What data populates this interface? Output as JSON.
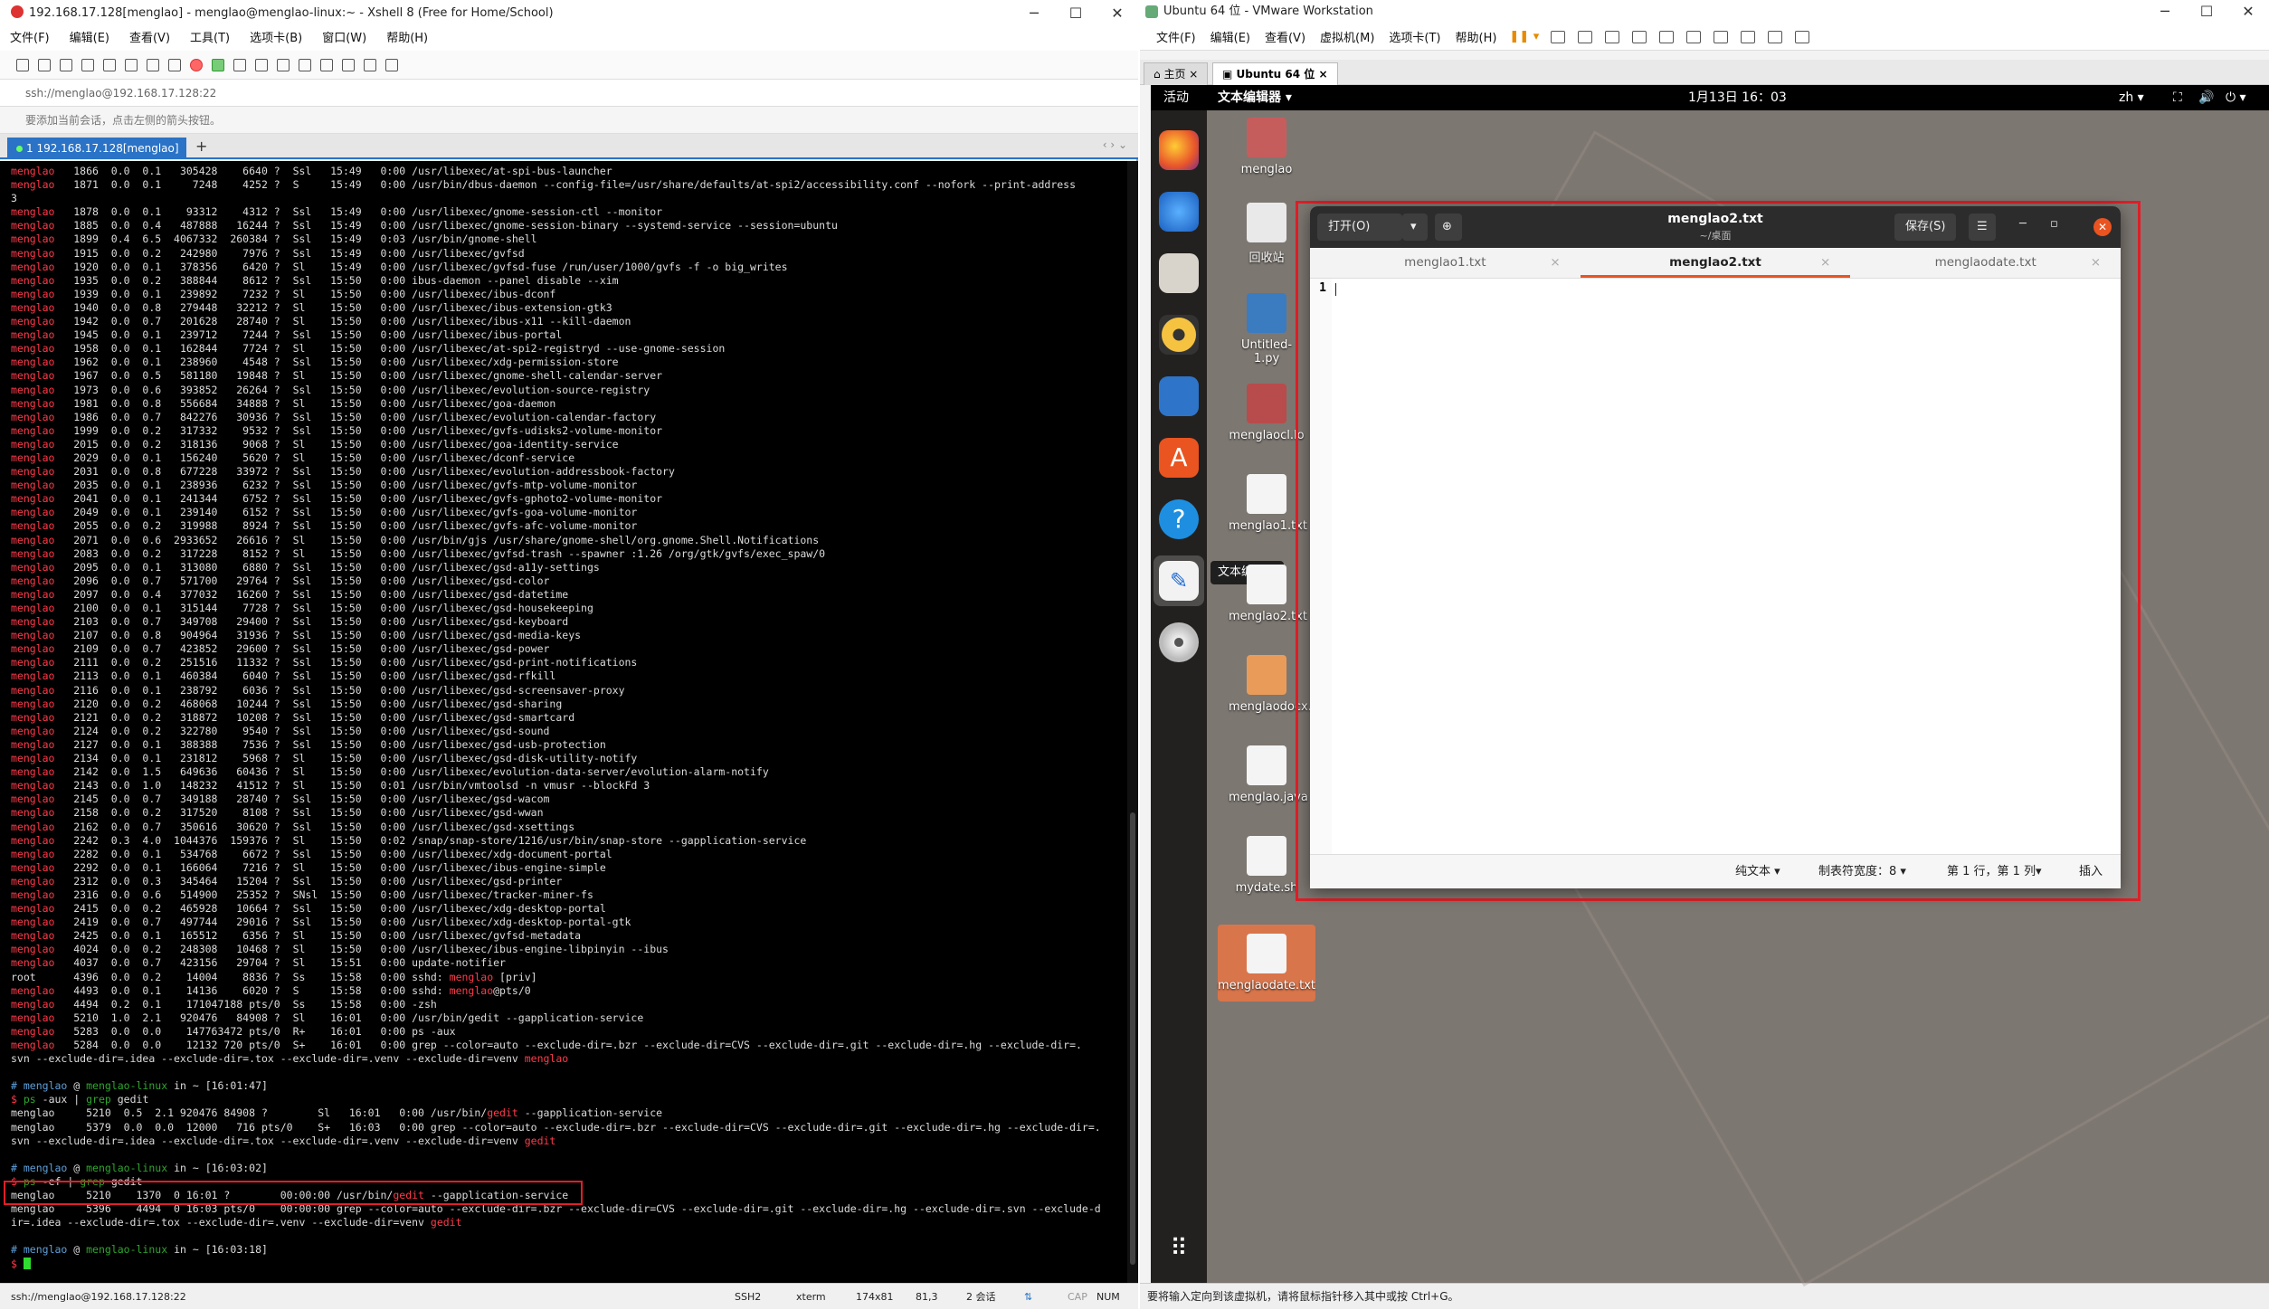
{
  "xshell": {
    "title": "192.168.17.128[menglao] - menglao@menglao-linux:~ - Xshell 8 (Free for Home/School)",
    "menu": [
      "文件(F)",
      "编辑(E)",
      "查看(V)",
      "工具(T)",
      "选项卡(B)",
      "窗口(W)",
      "帮助(H)"
    ],
    "address": "ssh://menglao@192.168.17.128:22",
    "hint": "要添加当前会话，点击左侧的箭头按钮。",
    "tab_label": "1 192.168.17.128[menglao]",
    "status": {
      "conn": "ssh://menglao@192.168.17.128:22",
      "proto": "SSH2",
      "term": "xterm",
      "size": "174x81",
      "pos": "81,3",
      "sessions": "2 会话",
      "caps": "CAP",
      "num": "NUM"
    }
  },
  "terminal": {
    "processes": [
      [
        "menglao",
        "1866",
        "0.0",
        "0.1",
        "305428",
        "6640 ?",
        "Ssl",
        "15:49",
        "0:00 /usr/libexec/at-spi-bus-launcher"
      ],
      [
        "menglao",
        "1871",
        "0.0",
        "0.1",
        "7248",
        "4252 ?",
        "S",
        "15:49",
        "0:00 /usr/bin/dbus-daemon --config-file=/usr/share/defaults/at-spi2/accessibility.conf --nofork --print-address"
      ],
      [
        "",
        "",
        "",
        "",
        "",
        "",
        "",
        "",
        "3"
      ],
      [
        "menglao",
        "1878",
        "0.0",
        "0.1",
        "93312",
        "4312 ?",
        "Ssl",
        "15:49",
        "0:00 /usr/libexec/gnome-session-ctl --monitor"
      ],
      [
        "menglao",
        "1885",
        "0.0",
        "0.4",
        "487888",
        "16244 ?",
        "Ssl",
        "15:49",
        "0:00 /usr/libexec/gnome-session-binary --systemd-service --session=ubuntu"
      ],
      [
        "menglao",
        "1899",
        "0.4",
        "6.5",
        "4067332",
        "260384 ?",
        "Ssl",
        "15:49",
        "0:03 /usr/bin/gnome-shell"
      ],
      [
        "menglao",
        "1915",
        "0.0",
        "0.2",
        "242980",
        "7976 ?",
        "Ssl",
        "15:49",
        "0:00 /usr/libexec/gvfsd"
      ],
      [
        "menglao",
        "1920",
        "0.0",
        "0.1",
        "378356",
        "6420 ?",
        "Sl",
        "15:49",
        "0:00 /usr/libexec/gvfsd-fuse /run/user/1000/gvfs -f -o big_writes"
      ],
      [
        "menglao",
        "1935",
        "0.0",
        "0.2",
        "388844",
        "8612 ?",
        "Ssl",
        "15:50",
        "0:00 ibus-daemon --panel disable --xim"
      ],
      [
        "menglao",
        "1939",
        "0.0",
        "0.1",
        "239892",
        "7232 ?",
        "Sl",
        "15:50",
        "0:00 /usr/libexec/ibus-dconf"
      ],
      [
        "menglao",
        "1940",
        "0.0",
        "0.8",
        "279448",
        "32212 ?",
        "Sl",
        "15:50",
        "0:00 /usr/libexec/ibus-extension-gtk3"
      ],
      [
        "menglao",
        "1942",
        "0.0",
        "0.7",
        "201628",
        "28740 ?",
        "Sl",
        "15:50",
        "0:00 /usr/libexec/ibus-x11 --kill-daemon"
      ],
      [
        "menglao",
        "1945",
        "0.0",
        "0.1",
        "239712",
        "7244 ?",
        "Ssl",
        "15:50",
        "0:00 /usr/libexec/ibus-portal"
      ],
      [
        "menglao",
        "1958",
        "0.0",
        "0.1",
        "162844",
        "7724 ?",
        "Sl",
        "15:50",
        "0:00 /usr/libexec/at-spi2-registryd --use-gnome-session"
      ],
      [
        "menglao",
        "1962",
        "0.0",
        "0.1",
        "238960",
        "4548 ?",
        "Ssl",
        "15:50",
        "0:00 /usr/libexec/xdg-permission-store"
      ],
      [
        "menglao",
        "1967",
        "0.0",
        "0.5",
        "581180",
        "19848 ?",
        "Sl",
        "15:50",
        "0:00 /usr/libexec/gnome-shell-calendar-server"
      ],
      [
        "menglao",
        "1973",
        "0.0",
        "0.6",
        "393852",
        "26264 ?",
        "Ssl",
        "15:50",
        "0:00 /usr/libexec/evolution-source-registry"
      ],
      [
        "menglao",
        "1981",
        "0.0",
        "0.8",
        "556684",
        "34888 ?",
        "Sl",
        "15:50",
        "0:00 /usr/libexec/goa-daemon"
      ],
      [
        "menglao",
        "1986",
        "0.0",
        "0.7",
        "842276",
        "30936 ?",
        "Ssl",
        "15:50",
        "0:00 /usr/libexec/evolution-calendar-factory"
      ],
      [
        "menglao",
        "1999",
        "0.0",
        "0.2",
        "317332",
        "9532 ?",
        "Ssl",
        "15:50",
        "0:00 /usr/libexec/gvfs-udisks2-volume-monitor"
      ],
      [
        "menglao",
        "2015",
        "0.0",
        "0.2",
        "318136",
        "9068 ?",
        "Sl",
        "15:50",
        "0:00 /usr/libexec/goa-identity-service"
      ],
      [
        "menglao",
        "2029",
        "0.0",
        "0.1",
        "156240",
        "5620 ?",
        "Sl",
        "15:50",
        "0:00 /usr/libexec/dconf-service"
      ],
      [
        "menglao",
        "2031",
        "0.0",
        "0.8",
        "677228",
        "33972 ?",
        "Ssl",
        "15:50",
        "0:00 /usr/libexec/evolution-addressbook-factory"
      ],
      [
        "menglao",
        "2035",
        "0.0",
        "0.1",
        "238936",
        "6232 ?",
        "Ssl",
        "15:50",
        "0:00 /usr/libexec/gvfs-mtp-volume-monitor"
      ],
      [
        "menglao",
        "2041",
        "0.0",
        "0.1",
        "241344",
        "6752 ?",
        "Ssl",
        "15:50",
        "0:00 /usr/libexec/gvfs-gphoto2-volume-monitor"
      ],
      [
        "menglao",
        "2049",
        "0.0",
        "0.1",
        "239140",
        "6152 ?",
        "Ssl",
        "15:50",
        "0:00 /usr/libexec/gvfs-goa-volume-monitor"
      ],
      [
        "menglao",
        "2055",
        "0.0",
        "0.2",
        "319988",
        "8924 ?",
        "Ssl",
        "15:50",
        "0:00 /usr/libexec/gvfs-afc-volume-monitor"
      ],
      [
        "menglao",
        "2071",
        "0.0",
        "0.6",
        "2933652",
        "26616 ?",
        "Sl",
        "15:50",
        "0:00 /usr/bin/gjs /usr/share/gnome-shell/org.gnome.Shell.Notifications"
      ],
      [
        "menglao",
        "2083",
        "0.0",
        "0.2",
        "317228",
        "8152 ?",
        "Sl",
        "15:50",
        "0:00 /usr/libexec/gvfsd-trash --spawner :1.26 /org/gtk/gvfs/exec_spaw/0"
      ],
      [
        "menglao",
        "2095",
        "0.0",
        "0.1",
        "313080",
        "6880 ?",
        "Ssl",
        "15:50",
        "0:00 /usr/libexec/gsd-a11y-settings"
      ],
      [
        "menglao",
        "2096",
        "0.0",
        "0.7",
        "571700",
        "29764 ?",
        "Ssl",
        "15:50",
        "0:00 /usr/libexec/gsd-color"
      ],
      [
        "menglao",
        "2097",
        "0.0",
        "0.4",
        "377032",
        "16260 ?",
        "Ssl",
        "15:50",
        "0:00 /usr/libexec/gsd-datetime"
      ],
      [
        "menglao",
        "2100",
        "0.0",
        "0.1",
        "315144",
        "7728 ?",
        "Ssl",
        "15:50",
        "0:00 /usr/libexec/gsd-housekeeping"
      ],
      [
        "menglao",
        "2103",
        "0.0",
        "0.7",
        "349708",
        "29400 ?",
        "Ssl",
        "15:50",
        "0:00 /usr/libexec/gsd-keyboard"
      ],
      [
        "menglao",
        "2107",
        "0.0",
        "0.8",
        "904964",
        "31936 ?",
        "Ssl",
        "15:50",
        "0:00 /usr/libexec/gsd-media-keys"
      ],
      [
        "menglao",
        "2109",
        "0.0",
        "0.7",
        "423852",
        "29600 ?",
        "Ssl",
        "15:50",
        "0:00 /usr/libexec/gsd-power"
      ],
      [
        "menglao",
        "2111",
        "0.0",
        "0.2",
        "251516",
        "11332 ?",
        "Ssl",
        "15:50",
        "0:00 /usr/libexec/gsd-print-notifications"
      ],
      [
        "menglao",
        "2113",
        "0.0",
        "0.1",
        "460384",
        "6040 ?",
        "Ssl",
        "15:50",
        "0:00 /usr/libexec/gsd-rfkill"
      ],
      [
        "menglao",
        "2116",
        "0.0",
        "0.1",
        "238792",
        "6036 ?",
        "Ssl",
        "15:50",
        "0:00 /usr/libexec/gsd-screensaver-proxy"
      ],
      [
        "menglao",
        "2120",
        "0.0",
        "0.2",
        "468068",
        "10244 ?",
        "Ssl",
        "15:50",
        "0:00 /usr/libexec/gsd-sharing"
      ],
      [
        "menglao",
        "2121",
        "0.0",
        "0.2",
        "318872",
        "10208 ?",
        "Ssl",
        "15:50",
        "0:00 /usr/libexec/gsd-smartcard"
      ],
      [
        "menglao",
        "2124",
        "0.0",
        "0.2",
        "322780",
        "9540 ?",
        "Ssl",
        "15:50",
        "0:00 /usr/libexec/gsd-sound"
      ],
      [
        "menglao",
        "2127",
        "0.0",
        "0.1",
        "388388",
        "7536 ?",
        "Ssl",
        "15:50",
        "0:00 /usr/libexec/gsd-usb-protection"
      ],
      [
        "menglao",
        "2134",
        "0.0",
        "0.1",
        "231812",
        "5968 ?",
        "Sl",
        "15:50",
        "0:00 /usr/libexec/gsd-disk-utility-notify"
      ],
      [
        "menglao",
        "2142",
        "0.0",
        "1.5",
        "649636",
        "60436 ?",
        "Sl",
        "15:50",
        "0:00 /usr/libexec/evolution-data-server/evolution-alarm-notify"
      ],
      [
        "menglao",
        "2143",
        "0.0",
        "1.0",
        "148232",
        "41512 ?",
        "Sl",
        "15:50",
        "0:01 /usr/bin/vmtoolsd -n vmusr --blockFd 3"
      ],
      [
        "menglao",
        "2145",
        "0.0",
        "0.7",
        "349188",
        "28740 ?",
        "Ssl",
        "15:50",
        "0:00 /usr/libexec/gsd-wacom"
      ],
      [
        "menglao",
        "2158",
        "0.0",
        "0.2",
        "317520",
        "8108 ?",
        "Ssl",
        "15:50",
        "0:00 /usr/libexec/gsd-wwan"
      ],
      [
        "menglao",
        "2162",
        "0.0",
        "0.7",
        "350616",
        "30620 ?",
        "Ssl",
        "15:50",
        "0:00 /usr/libexec/gsd-xsettings"
      ],
      [
        "menglao",
        "2242",
        "0.3",
        "4.0",
        "1044376",
        "159376 ?",
        "Sl",
        "15:50",
        "0:02 /snap/snap-store/1216/usr/bin/snap-store --gapplication-service"
      ],
      [
        "menglao",
        "2282",
        "0.0",
        "0.1",
        "534768",
        "6672 ?",
        "Ssl",
        "15:50",
        "0:00 /usr/libexec/xdg-document-portal"
      ],
      [
        "menglao",
        "2292",
        "0.0",
        "0.1",
        "166064",
        "7216 ?",
        "Sl",
        "15:50",
        "0:00 /usr/libexec/ibus-engine-simple"
      ],
      [
        "menglao",
        "2312",
        "0.0",
        "0.3",
        "345464",
        "15204 ?",
        "Ssl",
        "15:50",
        "0:00 /usr/libexec/gsd-printer"
      ],
      [
        "menglao",
        "2316",
        "0.0",
        "0.6",
        "514900",
        "25352 ?",
        "SNsl",
        "15:50",
        "0:00 /usr/libexec/tracker-miner-fs"
      ],
      [
        "menglao",
        "2415",
        "0.0",
        "0.2",
        "465928",
        "10664 ?",
        "Ssl",
        "15:50",
        "0:00 /usr/libexec/xdg-desktop-portal"
      ],
      [
        "menglao",
        "2419",
        "0.0",
        "0.7",
        "497744",
        "29016 ?",
        "Ssl",
        "15:50",
        "0:00 /usr/libexec/xdg-desktop-portal-gtk"
      ],
      [
        "menglao",
        "2425",
        "0.0",
        "0.1",
        "165512",
        "6356 ?",
        "Sl",
        "15:50",
        "0:00 /usr/libexec/gvfsd-metadata"
      ],
      [
        "menglao",
        "4024",
        "0.0",
        "0.2",
        "248308",
        "10468 ?",
        "Sl",
        "15:50",
        "0:00 /usr/libexec/ibus-engine-libpinyin --ibus"
      ],
      [
        "menglao",
        "4037",
        "0.0",
        "0.7",
        "423156",
        "29704 ?",
        "Sl",
        "15:51",
        "0:00 update-notifier"
      ],
      [
        "root",
        "4396",
        "0.0",
        "0.2",
        "14004",
        "8836 ?",
        "Ss",
        "15:58",
        "0:00 sshd: menglao [priv]"
      ],
      [
        "menglao",
        "4493",
        "0.0",
        "0.1",
        "14136",
        "6020 ?",
        "S",
        "15:58",
        "0:00 sshd: menglao@pts/0"
      ],
      [
        "menglao",
        "4494",
        "0.2",
        "0.1",
        "17104",
        "7188 pts/0",
        "Ss",
        "15:58",
        "0:00 -zsh"
      ],
      [
        "menglao",
        "5210",
        "1.0",
        "2.1",
        "920476",
        "84908 ?",
        "Sl",
        "16:01",
        "0:00 /usr/bin/gedit --gapplication-service"
      ],
      [
        "menglao",
        "5283",
        "0.0",
        "0.0",
        "14776",
        "3472 pts/0",
        "R+",
        "16:01",
        "0:00 ps -aux"
      ],
      [
        "menglao",
        "5284",
        "0.0",
        "0.0",
        "12132",
        "720 pts/0",
        "S+",
        "16:01",
        "0:00 grep --color=auto --exclude-dir=.bzr --exclude-dir=CVS --exclude-dir=.git --exclude-dir=.hg --exclude-dir=."
      ]
    ],
    "tail": [
      "svn --exclude-dir=.idea --exclude-dir=.tox --exclude-dir=.venv --exclude-dir=venv menglao",
      "",
      "# menglao @ menglao-linux in ~ [16:01:47]",
      "$ ps -aux | grep gedit",
      "menglao     5210  0.5  2.1 920476 84908 ?        Sl   16:01   0:00 /usr/bin/gedit --gapplication-service",
      "menglao     5379  0.0  0.0  12000   716 pts/0    S+   16:03   0:00 grep --color=auto --exclude-dir=.bzr --exclude-dir=CVS --exclude-dir=.git --exclude-dir=.hg --exclude-dir=.",
      "svn --exclude-dir=.idea --exclude-dir=.tox --exclude-dir=.venv --exclude-dir=venv gedit",
      "",
      "# menglao @ menglao-linux in ~ [16:03:02]",
      "$ ps -ef | grep gedit",
      "menglao     5210    1370  0 16:01 ?        00:00:00 /usr/bin/gedit --gapplication-service",
      "menglao     5396    4494  0 16:03 pts/0    00:00:00 grep --color=auto --exclude-dir=.bzr --exclude-dir=CVS --exclude-dir=.git --exclude-dir=.hg --exclude-dir=.svn --exclude-d",
      "ir=.idea --exclude-dir=.tox --exclude-dir=.venv --exclude-dir=venv gedit",
      "",
      "# menglao @ menglao-linux in ~ [16:03:18]",
      "$ "
    ]
  },
  "vmware": {
    "title": "Ubuntu 64 位 - VMware Workstation",
    "menu": [
      "文件(F)",
      "编辑(E)",
      "查看(V)",
      "虚拟机(M)",
      "选项卡(T)",
      "帮助(H)"
    ],
    "tabs": [
      "主页",
      "Ubuntu 64 位"
    ],
    "status": "要将输入定向到该虚拟机，请将鼠标指针移入其中或按 Ctrl+G。"
  },
  "ubuntu": {
    "activities": "活动",
    "app_menu": "文本编辑器 ▾",
    "clock": "1月13日  16：03",
    "lang": "zh ▾",
    "tooltip": "文本编辑器",
    "desktop_icons": [
      "menglao",
      "回收站",
      "Untitled-1.py",
      "menglaocl.lo",
      "menglao1.txt",
      "menglao2.txt",
      "menglaodocx.gz",
      "menglao.java",
      "mydate.sh",
      "menglaodate.txt"
    ]
  },
  "gedit": {
    "open_label": "打开(O)",
    "title": "menglao2.txt",
    "subtitle": "~/桌面",
    "save_label": "保存(S)",
    "tabs": [
      "menglao1.txt",
      "menglao2.txt",
      "menglaodate.txt"
    ],
    "line_number": "1",
    "status": {
      "lang": "纯文本 ▾",
      "tab_width": "制表符宽度：8 ▾",
      "position": "第 1 行，第 1 列",
      "mode": "插入"
    }
  },
  "colors": {
    "accent": "#e95420",
    "annotation": "#e01e27",
    "terminal_user": "#ff3a4a"
  }
}
